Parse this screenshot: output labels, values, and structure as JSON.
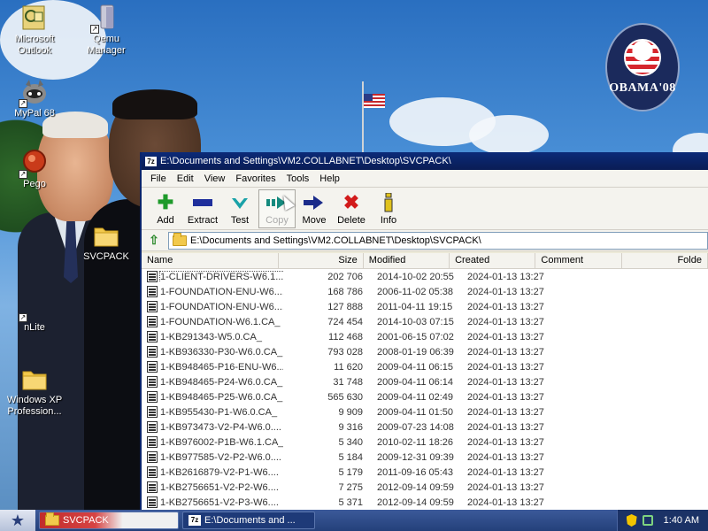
{
  "desktop": {
    "icons": [
      {
        "label": "Microsoft Outlook",
        "icon": "outlook-icon"
      },
      {
        "label": "Qemu Manager",
        "icon": "qemu-icon"
      },
      {
        "label": "MyPal 68",
        "icon": "mypal-icon"
      },
      {
        "label": "Pego",
        "icon": "pego-icon"
      },
      {
        "label": "SVCPACK",
        "icon": "folder-icon"
      },
      {
        "label": "nLite",
        "icon": "nlite-icon"
      },
      {
        "label": "Windows XP Profession...",
        "icon": "folder-icon"
      }
    ],
    "wallpaper_logo": "OBAMA'08"
  },
  "window": {
    "title": "E:\\Documents and Settings\\VM2.COLLABNET\\Desktop\\SVCPACK\\",
    "app_icon": "7z",
    "menu": [
      "File",
      "Edit",
      "View",
      "Favorites",
      "Tools",
      "Help"
    ],
    "toolbar": [
      {
        "label": "Add",
        "icon": "add-icon",
        "color": "#1e9a2a"
      },
      {
        "label": "Extract",
        "icon": "extract-icon",
        "color": "#1f2f9c"
      },
      {
        "label": "Test",
        "icon": "test-icon",
        "color": "#1aa2a8"
      },
      {
        "label": "Copy",
        "icon": "copy-icon",
        "color": "#158a7e"
      },
      {
        "label": "Move",
        "icon": "move-icon",
        "color": "#1b2b8a"
      },
      {
        "label": "Delete",
        "icon": "delete-icon",
        "color": "#d21b1b"
      },
      {
        "label": "Info",
        "icon": "info-icon",
        "color": "#e0c21c"
      }
    ],
    "address": "E:\\Documents and Settings\\VM2.COLLABNET\\Desktop\\SVCPACK\\",
    "columns": [
      "Name",
      "Size",
      "Modified",
      "Created",
      "Comment",
      "Folde"
    ],
    "files": [
      {
        "name": "1-CLIENT-DRIVERS-W6.1....",
        "size": "202 706",
        "modified": "2014-10-02 20:55",
        "created": "2024-01-13 13:27"
      },
      {
        "name": "1-FOUNDATION-ENU-W6....",
        "size": "168 786",
        "modified": "2006-11-02 05:38",
        "created": "2024-01-13 13:27"
      },
      {
        "name": "1-FOUNDATION-ENU-W6....",
        "size": "127 888",
        "modified": "2011-04-11 19:15",
        "created": "2024-01-13 13:27"
      },
      {
        "name": "1-FOUNDATION-W6.1.CA_",
        "size": "724 454",
        "modified": "2014-10-03 07:15",
        "created": "2024-01-13 13:27"
      },
      {
        "name": "1-KB291343-W5.0.CA_",
        "size": "112 468",
        "modified": "2001-06-15 07:02",
        "created": "2024-01-13 13:27"
      },
      {
        "name": "1-KB936330-P30-W6.0.CA_",
        "size": "793 028",
        "modified": "2008-01-19 06:39",
        "created": "2024-01-13 13:27"
      },
      {
        "name": "1-KB948465-P16-ENU-W6....",
        "size": "11 620",
        "modified": "2009-04-11 06:15",
        "created": "2024-01-13 13:27"
      },
      {
        "name": "1-KB948465-P24-W6.0.CA_",
        "size": "31 748",
        "modified": "2009-04-11 06:14",
        "created": "2024-01-13 13:27"
      },
      {
        "name": "1-KB948465-P25-W6.0.CA_",
        "size": "565 630",
        "modified": "2009-04-11 02:49",
        "created": "2024-01-13 13:27"
      },
      {
        "name": "1-KB955430-P1-W6.0.CA_",
        "size": "9 909",
        "modified": "2009-04-11 01:50",
        "created": "2024-01-13 13:27"
      },
      {
        "name": "1-KB973473-V2-P4-W6.0....",
        "size": "9 316",
        "modified": "2009-07-23 14:08",
        "created": "2024-01-13 13:27"
      },
      {
        "name": "1-KB976002-P1B-W6.1.CA_",
        "size": "5 340",
        "modified": "2010-02-11 18:26",
        "created": "2024-01-13 13:27"
      },
      {
        "name": "1-KB977585-V2-P2-W6.0....",
        "size": "5 184",
        "modified": "2009-12-31 09:39",
        "created": "2024-01-13 13:27"
      },
      {
        "name": "1-KB2616879-V2-P1-W6....",
        "size": "5 179",
        "modified": "2011-09-16 05:43",
        "created": "2024-01-13 13:27"
      },
      {
        "name": "1-KB2756651-V2-P2-W6....",
        "size": "7 275",
        "modified": "2012-09-14 09:59",
        "created": "2024-01-13 13:27"
      },
      {
        "name": "1-KB2756651-V2-P3-W6....",
        "size": "5 371",
        "modified": "2012-09-14 09:59",
        "created": "2024-01-13 13:27"
      }
    ]
  },
  "taskbar": {
    "tasks": [
      {
        "label": "SVCPACK",
        "icon": "folder-icon"
      },
      {
        "label": "E:\\Documents and ...",
        "icon": "7z"
      }
    ],
    "clock": "1:40 AM"
  }
}
